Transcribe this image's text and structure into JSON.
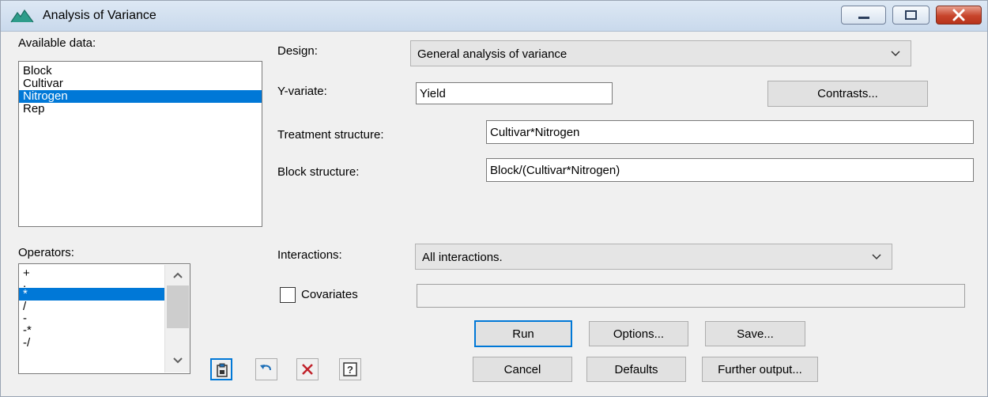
{
  "window": {
    "title": "Analysis of Variance"
  },
  "available_data": {
    "label": "Available data:",
    "items": [
      "Block",
      "Cultivar",
      "Nitrogen",
      "Rep"
    ],
    "selected": "Nitrogen"
  },
  "operators": {
    "label": "Operators:",
    "items": [
      "+",
      ".",
      "*",
      "/",
      "-",
      "-*",
      "-/"
    ],
    "selected": "*"
  },
  "form": {
    "design_label": "Design:",
    "design_value": "General analysis of variance",
    "yvariate_label": "Y-variate:",
    "yvariate_value": "Yield",
    "treatment_label": "Treatment structure:",
    "treatment_value": "Cultivar*Nitrogen",
    "block_label": "Block structure:",
    "block_value": "Block/(Cultivar*Nitrogen)",
    "interactions_label": "Interactions:",
    "interactions_value": "All interactions.",
    "covariates_label": "Covariates",
    "covariates_value": ""
  },
  "buttons": {
    "contrasts": "Contrasts...",
    "run": "Run",
    "options": "Options...",
    "save": "Save...",
    "cancel": "Cancel",
    "defaults": "Defaults",
    "further_output": "Further output..."
  },
  "toolbar_icons": [
    "clipboard-icon",
    "undo-icon",
    "clear-icon",
    "help-icon"
  ],
  "colors": {
    "selection": "#0078d7",
    "titlebar": "#c9d9ec",
    "close_button": "#c7442b"
  }
}
